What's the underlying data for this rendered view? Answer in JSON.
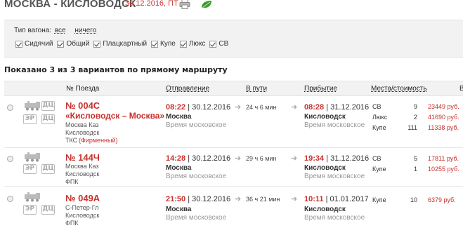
{
  "header": {
    "title": "МОСКВА - КИСЛОВОДСК",
    "date": "30.12.2016, ПТ"
  },
  "filters": {
    "wagon_type_label": "Тип вагона:",
    "all": "все",
    "none": "ничего",
    "checkboxes": [
      "Сидячий",
      "Общий",
      "Плацкартный",
      "Купе",
      "Люкс",
      "СВ"
    ]
  },
  "summary": "Показано 3 из 3 вариантов по прямому маршруту",
  "columns": {
    "train": "№ Поезда",
    "departure": "Отправление",
    "in_transit": "В пути",
    "arrival": "Прибытие",
    "seats": "Места/стоимость",
    "edge": "В"
  },
  "badges": {
    "er": "ЭР",
    "dc": "ДЦ"
  },
  "trains": [
    {
      "number": "№ 004С",
      "name": "«Кисловодск – Москва»",
      "route_from": "Москва Каз",
      "route_to": "Кисловодск",
      "carrier": "ТКС",
      "carrier_note": "(Фирменный)",
      "dep_time": "08:22",
      "dep_date": "| 30.12.2016",
      "dep_city": "Москва",
      "dep_tz": "Время московское",
      "duration": "24 ч 6 мин",
      "arr_time": "08:28",
      "arr_date": "| 31.12.2016",
      "arr_city": "Кисловодск",
      "arr_tz": "Время московское",
      "seats": [
        {
          "cls": "СВ",
          "n": "9",
          "price": "23449 руб."
        },
        {
          "cls": "Люкс",
          "n": "2",
          "price": "41690 руб."
        },
        {
          "cls": "Купе",
          "n": "111",
          "price": "11338 руб."
        }
      ]
    },
    {
      "number": "№ 144Ч",
      "route_from": "Москва Каз",
      "route_to": "Кисловодск",
      "carrier": "ФПК",
      "dep_time": "14:28",
      "dep_date": "| 30.12.2016",
      "dep_city": "Москва",
      "dep_tz": "Время московское",
      "duration": "29 ч 6 мин",
      "arr_time": "19:34",
      "arr_date": "| 31.12.2016",
      "arr_city": "Кисловодск",
      "arr_tz": "Время московское",
      "seats": [
        {
          "cls": "СВ",
          "n": "5",
          "price": "17811 руб."
        },
        {
          "cls": "Купе",
          "n": "1",
          "price": "10255 руб."
        }
      ]
    },
    {
      "number": "№ 049А",
      "route_from": "С-Петер-Гл",
      "route_to": "Кисловодск",
      "carrier": "ФПК",
      "dep_time": "21:50",
      "dep_date": "| 30.12.2016",
      "dep_city": "Москва",
      "dep_tz": "Время московское",
      "duration": "36 ч 21 мин",
      "arr_time": "10:11",
      "arr_date": "| 01.01.2017",
      "arr_city": "Кисловодск",
      "arr_tz": "Время московское",
      "seats": [
        {
          "cls": "Купе",
          "n": "10",
          "price": "6379 руб."
        }
      ]
    }
  ],
  "icons": {
    "print": "printer-icon",
    "eco": "leaf-icon",
    "arrow": "arrow-right-icon",
    "loco": "locomotive-icon"
  },
  "colors": {
    "accent": "#c8312d",
    "panel": "#f2f2f2",
    "muted": "#999999"
  }
}
